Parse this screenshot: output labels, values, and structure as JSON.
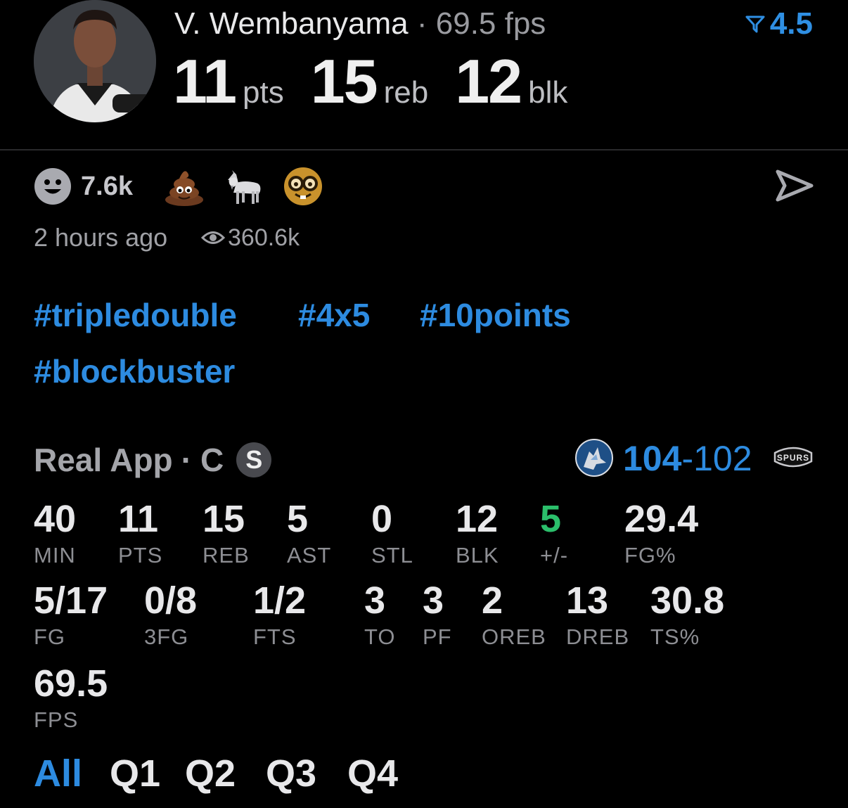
{
  "header": {
    "player_name": "V. Wembanyama",
    "separator": "·",
    "fps_text": "69.5 fps",
    "rating_value": "4.5",
    "stat_pts": "11",
    "unit_pts": "pts",
    "stat_reb": "15",
    "unit_reb": "reb",
    "stat_blk": "12",
    "unit_blk": "blk"
  },
  "reactions": {
    "count": "7.6k",
    "emojis": [
      "poop-emoji",
      "goat-emoji",
      "nerd-emoji"
    ]
  },
  "meta": {
    "time": "2 hours ago",
    "views": "360.6k"
  },
  "hashtags": [
    "#tripledouble",
    "#4x5",
    "#10points",
    "#blockbuster"
  ],
  "game": {
    "source": "Real App",
    "separator": "·",
    "position": "C",
    "badge": "S",
    "score_home": "104",
    "score_dash": "-",
    "score_away": "102"
  },
  "stats_row1": [
    {
      "value": "40",
      "label": "MIN"
    },
    {
      "value": "11",
      "label": "PTS"
    },
    {
      "value": "15",
      "label": "REB"
    },
    {
      "value": "5",
      "label": "AST"
    },
    {
      "value": "0",
      "label": "STL"
    },
    {
      "value": "12",
      "label": "BLK"
    },
    {
      "value": "5",
      "label": "+/-"
    },
    {
      "value": "29.4",
      "label": "FG%"
    }
  ],
  "stats_row2": [
    {
      "value": "5/17",
      "label": "FG"
    },
    {
      "value": "0/8",
      "label": "3FG"
    },
    {
      "value": "1/2",
      "label": "FTS"
    },
    {
      "value": "3",
      "label": "TO"
    },
    {
      "value": "3",
      "label": "PF"
    },
    {
      "value": "2",
      "label": "OREB"
    },
    {
      "value": "13",
      "label": "DREB"
    },
    {
      "value": "30.8",
      "label": "TS%"
    }
  ],
  "stats_row3": [
    {
      "value": "69.5",
      "label": "FPS"
    }
  ],
  "tabs": [
    "All",
    "Q1",
    "Q2",
    "Q3",
    "Q4"
  ],
  "colors": {
    "accent": "#2d8be0",
    "positive": "#2bbf6b",
    "background": "#000000"
  }
}
